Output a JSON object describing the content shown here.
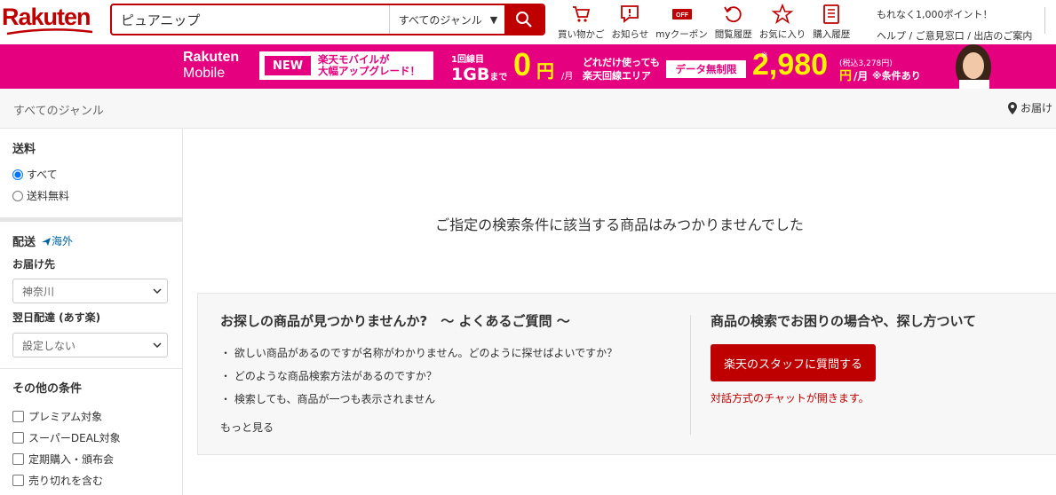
{
  "header": {
    "logo": "Rakuten",
    "search": {
      "value": "ピュアニップ",
      "genre": "すべてのジャンル",
      "genre_arrow": "▼"
    },
    "icons": [
      {
        "label": "買い物かご",
        "icon": "cart-icon"
      },
      {
        "label": "お知らせ",
        "icon": "notice-icon"
      },
      {
        "label": "myクーポン",
        "icon": "coupon-icon"
      },
      {
        "label": "閲覧履歴",
        "icon": "history-icon"
      },
      {
        "label": "お気に入り",
        "icon": "star-icon"
      },
      {
        "label": "購入履歴",
        "icon": "purchase-history-icon"
      }
    ],
    "points_text": "もれなく1,000ポイント！",
    "help_links": "ヘルプ / ご意見窓口 / 出店のご案内"
  },
  "banner": {
    "brand_line1": "Rakuten",
    "brand_line2": "Mobile",
    "new": "NEW",
    "new_text_line1": "楽天モバイルが",
    "new_text_line2": "大幅アップグレード！",
    "first_line": "1回線目",
    "gb": "1GB",
    "made": "まで",
    "zero": "0",
    "yen": "円",
    "per_month": "/月",
    "anyuse_line1": "どれだけ使っても",
    "anyuse_line2": "楽天回線エリア",
    "unlimited": "データ無制限",
    "asterisk": "※",
    "price": "2,980",
    "tax_in": "(税込3,278円)",
    "price_yen": "円",
    "price_month": "/月",
    "conditions": "※条件あり"
  },
  "breadcrumb": {
    "label": "すべてのジャンル",
    "deliver_to": "お届け"
  },
  "sidebar": {
    "shipping_title": "送料",
    "shipping_all": "すべて",
    "shipping_free": "送料無料",
    "delivery_title": "配送",
    "overseas": "海外",
    "destination_title": "お届け先",
    "destination_value": "神奈川",
    "nextday_title": "翌日配達 (あす楽)",
    "nextday_value": "設定しない",
    "other_title": "その他の条件",
    "checks": [
      "プレミアム対象",
      "スーパーDEAL対象",
      "定期購入・頒布会",
      "売り切れを含む"
    ]
  },
  "main": {
    "no_result": "ご指定の検索条件に該当する商品はみつかりませんでした",
    "faq_title": "お探しの商品が見つかりませんか?　～ よくあるご質問 ～",
    "faq_items": [
      "・ 欲しい商品があるのですが名称がわかりません。どのように探せばよいですか？",
      "・ どのような商品検索方法があるのですか？",
      "・ 検索しても、商品が一つも表示されません"
    ],
    "more": "もっと見る",
    "help_title": "商品の検索でお困りの場合や、探し方ついて",
    "staff_button": "楽天のスタッフに質問する",
    "chat_note": "対話方式のチャットが開きます。"
  },
  "colors": {
    "brand_red": "#bf0000",
    "banner_pink": "#e5007f",
    "banner_yellow": "#fff200"
  }
}
